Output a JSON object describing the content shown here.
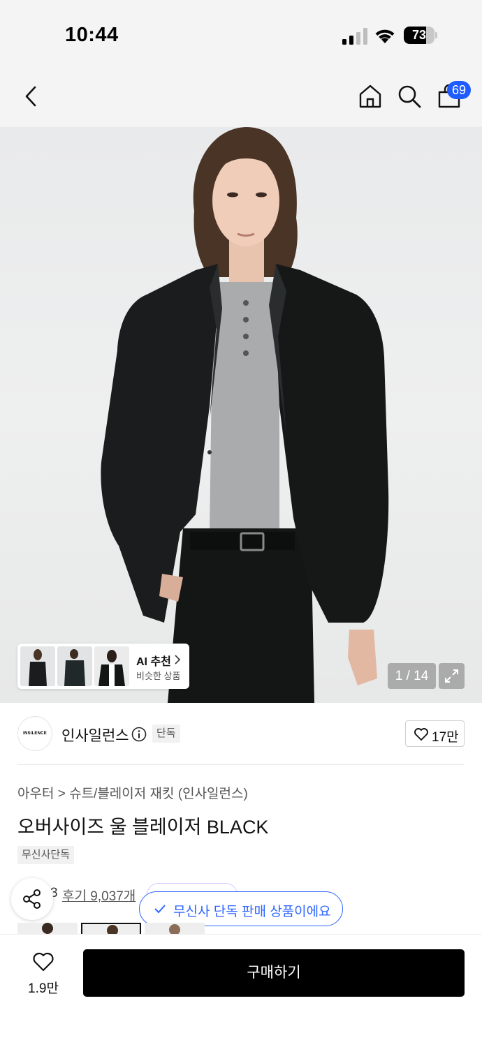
{
  "status_bar": {
    "time": "10:44",
    "battery_level": "73",
    "icons": [
      "signal-icon",
      "wifi-icon",
      "battery-icon"
    ]
  },
  "nav": {
    "icons": [
      "back-arrow-icon",
      "home-icon",
      "search-icon",
      "shopping-bag-icon"
    ],
    "cart_count": "69"
  },
  "gallery": {
    "counter": "1 / 14",
    "ai_recommend": {
      "title": "AI 추천",
      "subtitle": "비슷한 상품"
    }
  },
  "brand": {
    "logo_text": "INSILENCE",
    "name": "인사일런스",
    "badge": "단독",
    "likes": "17만"
  },
  "product": {
    "breadcrumb": "아우터 > 슈트/블레이저 재킷 (인사일런스)",
    "title": "오버사이즈 울 블레이저 BLACK",
    "exclusive_tag": "무신사단독",
    "rating_partial": "3",
    "reviews": "후기 9,037개"
  },
  "toast": {
    "message": "무신사 단독 판매 상품이에요"
  },
  "bottom_bar": {
    "wish_count": "1.9만",
    "buy_label": "구매하기"
  },
  "colors": {
    "accent_blue": "#2f66ff",
    "badge_blue": "#1f5cff",
    "buy_button": "#000000"
  }
}
